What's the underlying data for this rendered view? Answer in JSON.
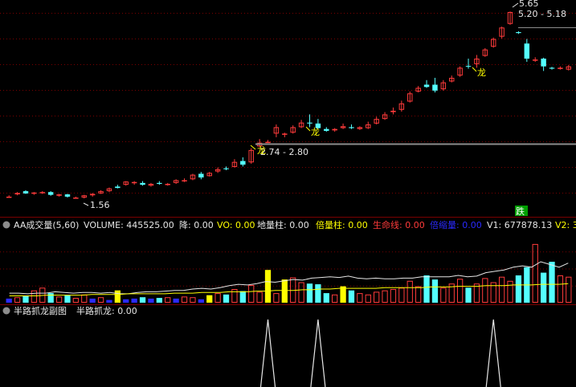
{
  "colors": {
    "background": "#000000",
    "up": "#ff3b3b",
    "down": "#54ffff",
    "yellow": "#ffff00",
    "white": "#e6e6e6",
    "gray": "#8c8c8c",
    "blue": "#2a2aff",
    "green": "#00c800",
    "grid": "#7a0000"
  },
  "main": {
    "annotations": {
      "low_price": "1.56",
      "high_price": "5.65",
      "high_range": "5.20 - 5.18",
      "ref_range": "2.74 - 2.80",
      "dragon_char": "龙",
      "fall_badge": "跌"
    }
  },
  "volume_panel": {
    "collapse_icon": "chevron-down-icon",
    "title": "AA成交量(5,60)",
    "volume_label": "VOLUME: 445525.00",
    "drop_label": "降: 0.00",
    "vo_label": "VO: 0.00",
    "ground_label": "地量柱: 0.00",
    "double_label": "倍量柱: 0.00",
    "life_label": "生命线: 0.00",
    "shrink_label": "倍缩量: 0.00",
    "v1_label": "V1: 677878.13",
    "v2_label": "V2: 3"
  },
  "sub_panel": {
    "title": "半路抓龙副图",
    "value_label": "半路抓龙: 0.00"
  },
  "chart_data": [
    {
      "type": "candlestick",
      "title": "",
      "ylim": [
        1.3,
        5.85
      ],
      "series": [
        {
          "name": "price",
          "ohlc": [
            [
              1.6,
              1.63,
              1.58,
              1.6
            ],
            [
              1.65,
              1.7,
              1.63,
              1.68
            ],
            [
              1.72,
              1.74,
              1.66,
              1.67
            ],
            [
              1.67,
              1.7,
              1.64,
              1.69
            ],
            [
              1.68,
              1.72,
              1.66,
              1.7
            ],
            [
              1.7,
              1.72,
              1.62,
              1.64
            ],
            [
              1.62,
              1.66,
              1.6,
              1.65
            ],
            [
              1.65,
              1.66,
              1.58,
              1.6
            ],
            [
              1.56,
              1.6,
              1.56,
              1.58
            ],
            [
              1.58,
              1.64,
              1.56,
              1.63
            ],
            [
              1.63,
              1.68,
              1.6,
              1.66
            ],
            [
              1.67,
              1.74,
              1.66,
              1.72
            ],
            [
              1.72,
              1.8,
              1.7,
              1.78
            ],
            [
              1.82,
              1.86,
              1.78,
              1.79
            ],
            [
              1.86,
              1.94,
              1.84,
              1.93
            ],
            [
              1.9,
              1.94,
              1.86,
              1.92
            ],
            [
              1.9,
              1.94,
              1.84,
              1.86
            ],
            [
              1.84,
              1.9,
              1.82,
              1.88
            ],
            [
              1.9,
              1.94,
              1.86,
              1.88
            ],
            [
              1.86,
              1.9,
              1.84,
              1.88
            ],
            [
              1.9,
              1.98,
              1.88,
              1.96
            ],
            [
              1.95,
              2.0,
              1.92,
              1.96
            ],
            [
              1.98,
              2.1,
              1.96,
              2.08
            ],
            [
              2.1,
              2.14,
              1.98,
              2.02
            ],
            [
              2.05,
              2.14,
              2.04,
              2.12
            ],
            [
              2.15,
              2.24,
              2.12,
              2.2
            ],
            [
              2.22,
              2.26,
              2.18,
              2.2
            ],
            [
              2.25,
              2.42,
              2.24,
              2.36
            ],
            [
              2.38,
              2.46,
              2.26,
              2.3
            ],
            [
              2.35,
              2.66,
              2.32,
              2.62
            ],
            [
              2.7,
              2.86,
              2.68,
              2.78
            ],
            [
              2.8,
              2.84,
              2.78,
              2.8
            ],
            [
              2.98,
              3.18,
              2.9,
              3.12
            ],
            [
              2.96,
              3.0,
              2.9,
              2.98
            ],
            [
              3.0,
              3.16,
              2.98,
              3.12
            ],
            [
              3.12,
              3.28,
              3.1,
              3.22
            ],
            [
              3.22,
              3.4,
              3.12,
              3.2
            ],
            [
              3.2,
              3.3,
              3.08,
              3.1
            ],
            [
              3.08,
              3.12,
              3.02,
              3.04
            ],
            [
              3.05,
              3.1,
              3.02,
              3.08
            ],
            [
              3.1,
              3.2,
              3.08,
              3.14
            ],
            [
              3.12,
              3.18,
              3.08,
              3.1
            ],
            [
              3.08,
              3.14,
              3.06,
              3.12
            ],
            [
              3.1,
              3.24,
              3.08,
              3.18
            ],
            [
              3.2,
              3.35,
              3.18,
              3.3
            ],
            [
              3.3,
              3.45,
              3.28,
              3.4
            ],
            [
              3.45,
              3.55,
              3.4,
              3.48
            ],
            [
              3.5,
              3.7,
              3.46,
              3.64
            ],
            [
              3.68,
              3.9,
              3.66,
              3.86
            ],
            [
              3.9,
              4.02,
              3.88,
              3.98
            ],
            [
              4.05,
              4.15,
              3.98,
              4.0
            ],
            [
              4.05,
              4.2,
              3.88,
              3.92
            ],
            [
              3.95,
              4.15,
              3.92,
              4.1
            ],
            [
              4.12,
              4.25,
              4.1,
              4.2
            ],
            [
              4.25,
              4.45,
              4.22,
              4.42
            ],
            [
              4.46,
              4.62,
              4.4,
              4.45
            ],
            [
              4.5,
              4.7,
              4.42,
              4.62
            ],
            [
              4.68,
              4.85,
              4.66,
              4.82
            ],
            [
              4.88,
              5.08,
              4.86,
              5.05
            ],
            [
              5.1,
              5.32,
              5.06,
              5.3
            ],
            [
              5.38,
              5.65,
              5.36,
              5.64
            ],
            [
              5.2,
              5.22,
              5.16,
              5.18
            ],
            [
              4.95,
              5.05,
              4.55,
              4.62
            ],
            [
              4.6,
              4.65,
              4.55,
              4.6
            ],
            [
              4.62,
              4.64,
              4.35,
              4.45
            ],
            [
              4.42,
              4.44,
              4.38,
              4.4
            ],
            [
              4.4,
              4.45,
              4.38,
              4.42
            ],
            [
              4.38,
              4.48,
              4.36,
              4.45
            ]
          ]
        }
      ]
    },
    {
      "type": "bar",
      "title": "AA成交量(5,60)",
      "ylim": [
        0,
        100
      ],
      "series": [
        {
          "name": "VOLUME",
          "values": [
            6,
            8,
            10,
            18,
            22,
            14,
            9,
            11,
            7,
            12,
            6,
            8,
            4,
            18,
            5,
            6,
            8,
            6,
            7,
            8,
            6,
            9,
            8,
            5,
            11,
            14,
            12,
            20,
            17,
            26,
            16,
            48,
            14,
            34,
            37,
            30,
            28,
            27,
            14,
            12,
            24,
            18,
            14,
            12,
            16,
            18,
            20,
            22,
            32,
            24,
            40,
            34,
            22,
            28,
            35,
            22,
            28,
            36,
            30,
            38,
            32,
            40,
            52,
            86,
            44,
            60,
            40,
            38,
            35,
            32
          ]
        },
        {
          "name": "life_line",
          "values": [
            14,
            14,
            13,
            14,
            14,
            16,
            15,
            14,
            15,
            15,
            14,
            15,
            13,
            13,
            15,
            16,
            16,
            17,
            18,
            18,
            20,
            21,
            20,
            22,
            25,
            27,
            26,
            28,
            31,
            30,
            32,
            34,
            33,
            36,
            37,
            38,
            37,
            39,
            36,
            35,
            36,
            35,
            35,
            36,
            36,
            38,
            38,
            38,
            38,
            40,
            38,
            39,
            44,
            46,
            48,
            52,
            54,
            52,
            60,
            56,
            52,
            58
          ]
        },
        {
          "name": "ma_line",
          "values": [
            10,
            10,
            10,
            10,
            11,
            11,
            11,
            11,
            11,
            12,
            12,
            12,
            12,
            13,
            13,
            13,
            13,
            13,
            14,
            14,
            14,
            15,
            15,
            15,
            16,
            16,
            16,
            17,
            17,
            18,
            18,
            18,
            19,
            19,
            20,
            20,
            21,
            21,
            21,
            21,
            21,
            22,
            22,
            22,
            22,
            22,
            23,
            23,
            23,
            24,
            24,
            24,
            25,
            25,
            25,
            26,
            26,
            26,
            27,
            27,
            27,
            28
          ]
        }
      ]
    },
    {
      "type": "line",
      "title": "半路抓龙副图",
      "ylim": [
        0,
        1
      ],
      "series": [
        {
          "name": "半路抓龙",
          "spikes_at_candle": [
            31,
            37,
            58
          ],
          "values": [
            1,
            1,
            1
          ]
        }
      ]
    }
  ]
}
